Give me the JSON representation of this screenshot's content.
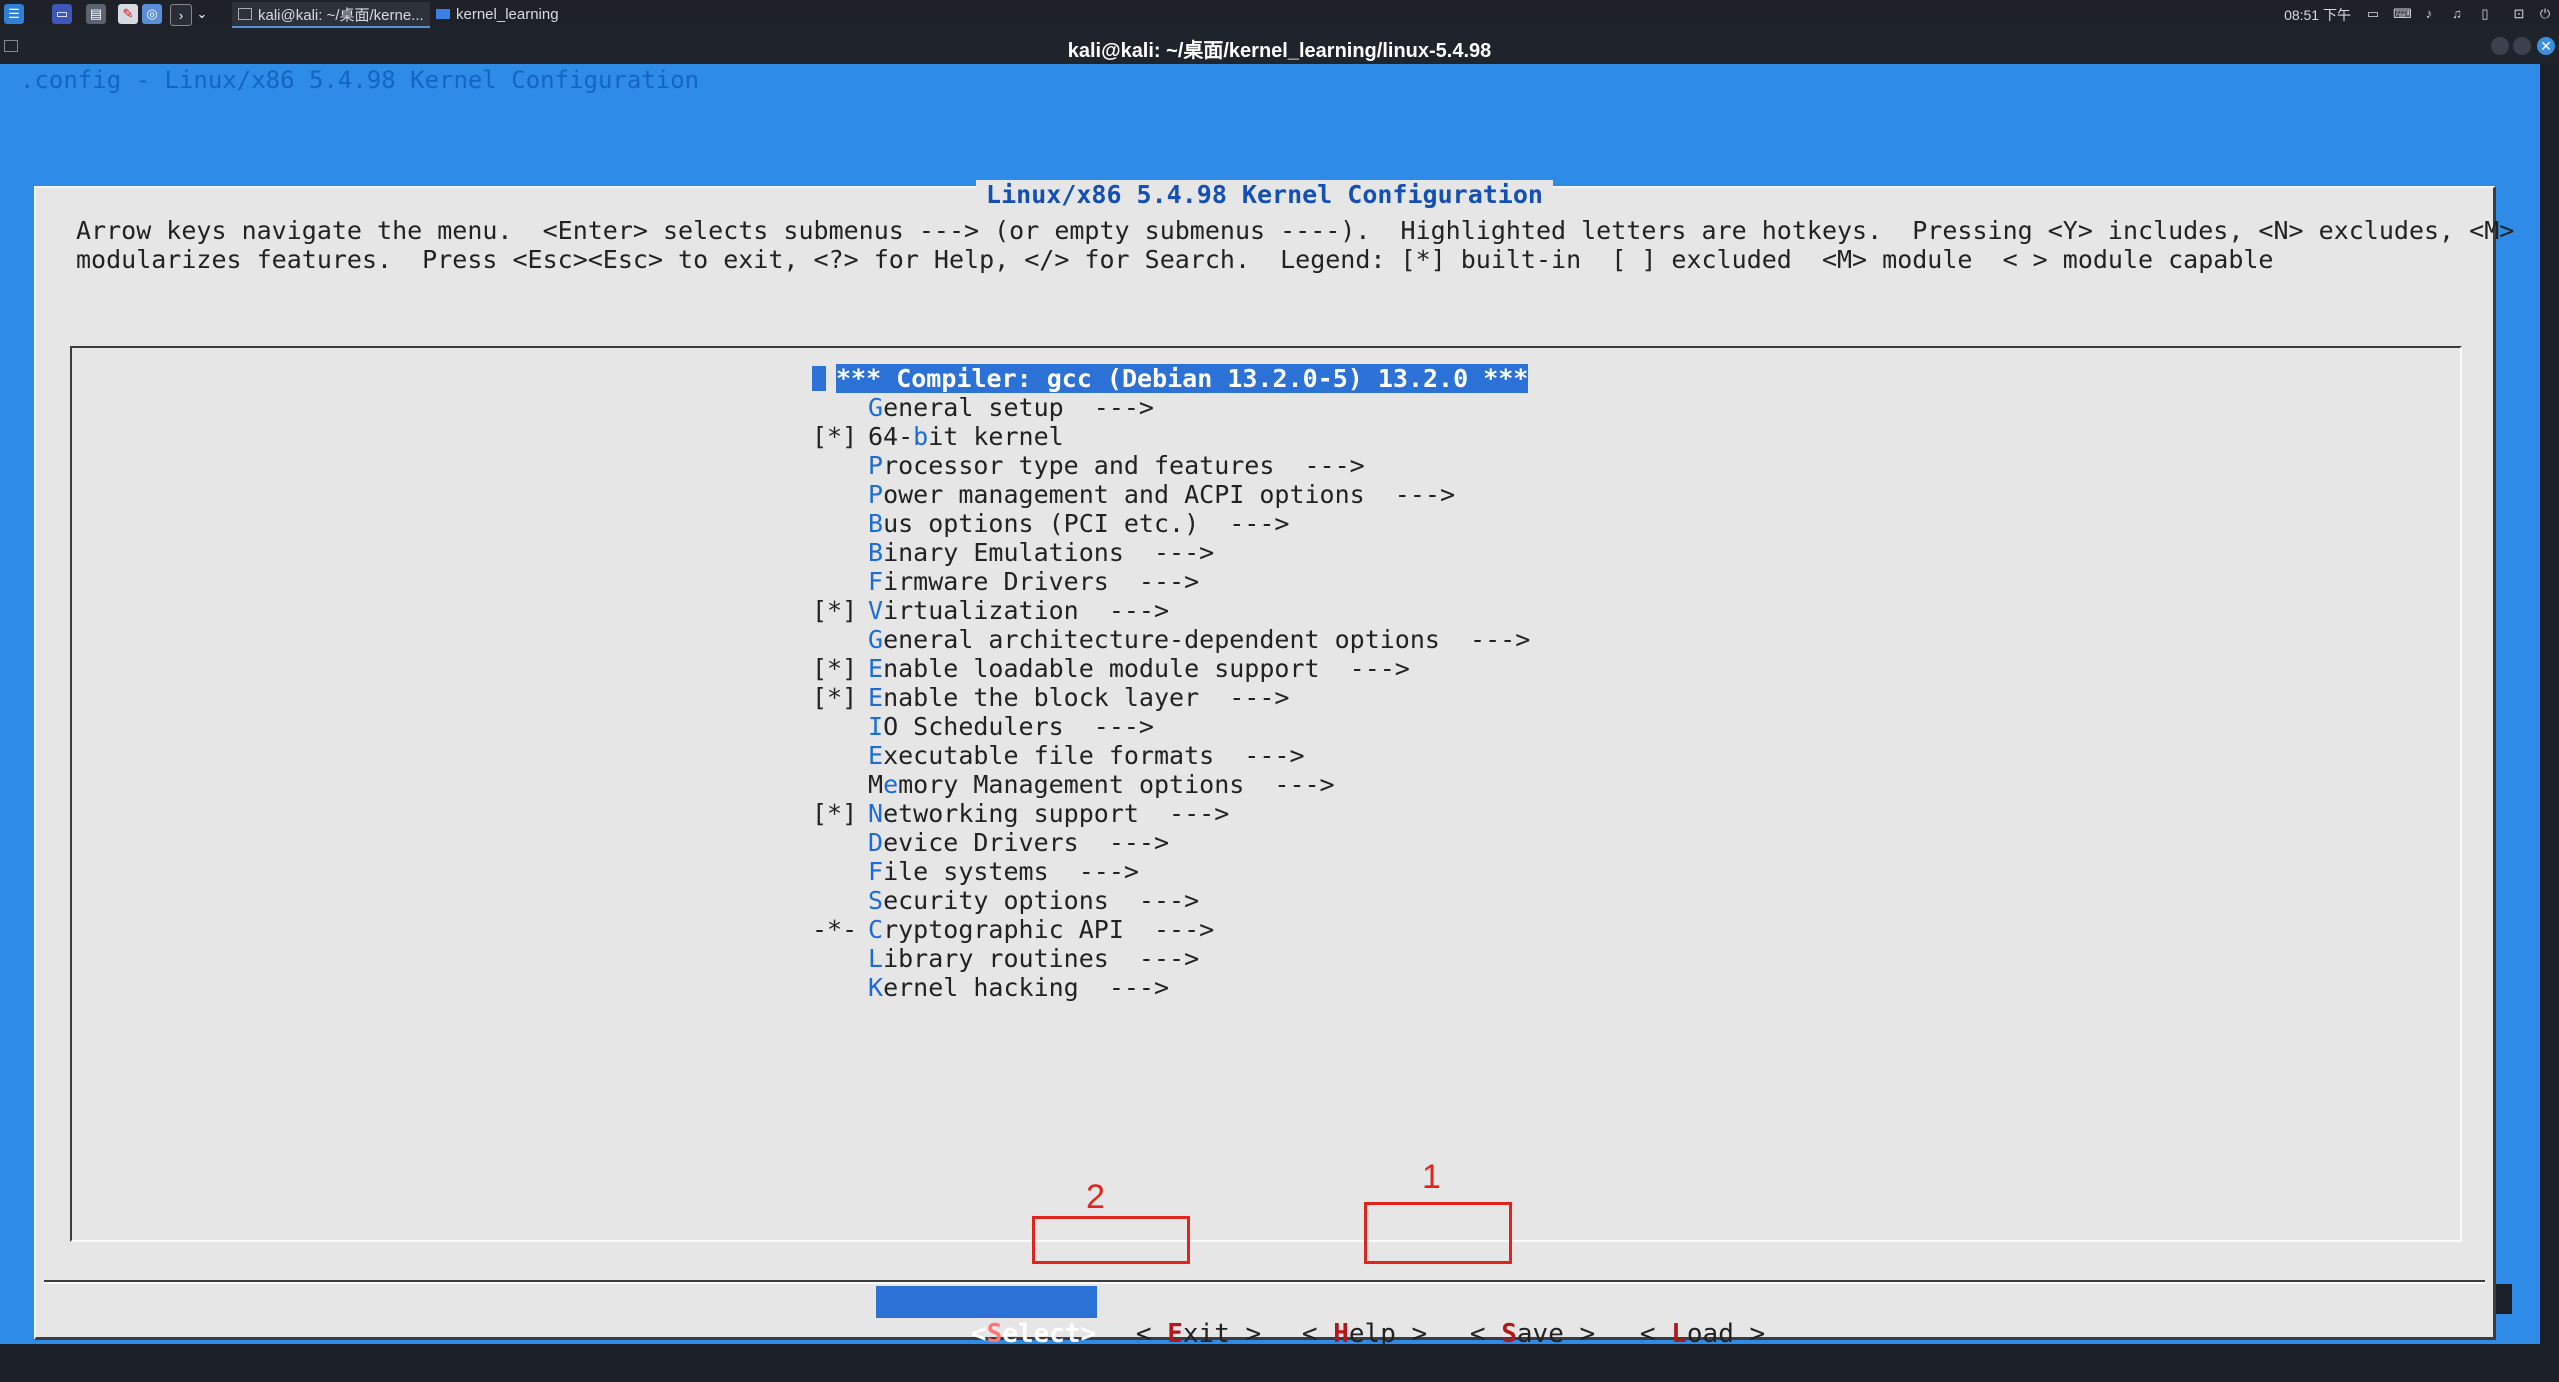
{
  "taskbar": {
    "tasks": [
      {
        "label": "kali@kali: ~/桌面/kerne...",
        "active": true
      },
      {
        "label": "kernel_learning",
        "active": false
      }
    ],
    "clock": "08:51 下午",
    "launcher_icons": [
      "kali-menu-icon",
      "desktop-icon",
      "file-manager-icon",
      "text-editor-icon",
      "browser-icon",
      "terminal-icon"
    ]
  },
  "window": {
    "title": "kali@kali: ~/桌面/kernel_learning/linux-5.4.98",
    "close_glyph": "✕"
  },
  "terminal": {
    "backtitle": ".config - Linux/x86 5.4.98 Kernel Configuration"
  },
  "dialog": {
    "title": "Linux/x86 5.4.98 Kernel Configuration",
    "help_lines": [
      "Arrow keys navigate the menu.  <Enter> selects submenus ---> (or empty submenus ----).  Highlighted letters are hotkeys.  Pressing <Y> includes, <N> excludes, <M>",
      "modularizes features.  Press <Esc><Esc> to exit, <?> for Help, </> for Search.  Legend: [*] built-in  [ ] excluded  <M> module  < > module capable"
    ],
    "menu_items": [
      {
        "mark": "",
        "pre": "",
        "hotkey": "",
        "post": "*** Compiler: gcc (Debian 13.2.0-5) 13.2.0 ***",
        "selected": true
      },
      {
        "mark": "",
        "pre": "",
        "hotkey": "G",
        "post": "eneral setup  --->"
      },
      {
        "mark": "[*]",
        "pre": "64-",
        "hotkey": "b",
        "post": "it kernel"
      },
      {
        "mark": "",
        "pre": "",
        "hotkey": "P",
        "post": "rocessor type and features  --->"
      },
      {
        "mark": "",
        "pre": "",
        "hotkey": "P",
        "post": "ower management and ACPI options  --->"
      },
      {
        "mark": "",
        "pre": "",
        "hotkey": "B",
        "post": "us options (PCI etc.)  --->"
      },
      {
        "mark": "",
        "pre": "",
        "hotkey": "B",
        "post": "inary Emulations  --->"
      },
      {
        "mark": "",
        "pre": "",
        "hotkey": "F",
        "post": "irmware Drivers  --->"
      },
      {
        "mark": "[*]",
        "pre": "",
        "hotkey": "V",
        "post": "irtualization  --->"
      },
      {
        "mark": "",
        "pre": "",
        "hotkey": "G",
        "post": "eneral architecture-dependent options  --->"
      },
      {
        "mark": "[*]",
        "pre": "",
        "hotkey": "E",
        "post": "nable loadable module support  --->"
      },
      {
        "mark": "[*]",
        "pre": "",
        "hotkey": "E",
        "post": "nable the block layer  --->"
      },
      {
        "mark": "",
        "pre": "",
        "hotkey": "I",
        "post": "O Schedulers  --->"
      },
      {
        "mark": "",
        "pre": "",
        "hotkey": "E",
        "post": "xecutable file formats  --->"
      },
      {
        "mark": "",
        "pre": "M",
        "hotkey": "e",
        "post": "mory Management options  --->"
      },
      {
        "mark": "[*]",
        "pre": "",
        "hotkey": "N",
        "post": "etworking support  --->"
      },
      {
        "mark": "",
        "pre": "",
        "hotkey": "D",
        "post": "evice Drivers  --->"
      },
      {
        "mark": "",
        "pre": "",
        "hotkey": "F",
        "post": "ile systems  --->"
      },
      {
        "mark": "",
        "pre": "",
        "hotkey": "S",
        "post": "ecurity options  --->"
      },
      {
        "mark": "-*-",
        "pre": "",
        "hotkey": "C",
        "post": "ryptographic API  --->"
      },
      {
        "mark": "",
        "pre": "",
        "hotkey": "L",
        "post": "ibrary routines  --->"
      },
      {
        "mark": "",
        "pre": "",
        "hotkey": "K",
        "post": "ernel hacking  --->"
      }
    ],
    "buttons": [
      {
        "id": "select",
        "pre": "<",
        "hotkey": "S",
        "post": "elect>"
      },
      {
        "id": "exit",
        "pre": "< ",
        "hotkey": "E",
        "post": "xit >"
      },
      {
        "id": "help",
        "pre": "< ",
        "hotkey": "H",
        "post": "elp >"
      },
      {
        "id": "save",
        "pre": "< ",
        "hotkey": "S",
        "post": "ave >"
      },
      {
        "id": "load",
        "pre": "< ",
        "hotkey": "L",
        "post": "oad >"
      }
    ]
  },
  "annotations": [
    {
      "label": "1",
      "target": "save"
    },
    {
      "label": "2",
      "target": "exit"
    }
  ],
  "colors": {
    "terminal_bg": "#2e8ce8",
    "dialog_bg": "#e6e6e6",
    "highlight": "#2b71d6",
    "hotkey_menu": "#1b6cd8",
    "hotkey_button": "#b3171c",
    "annotation": "#e0241e"
  }
}
